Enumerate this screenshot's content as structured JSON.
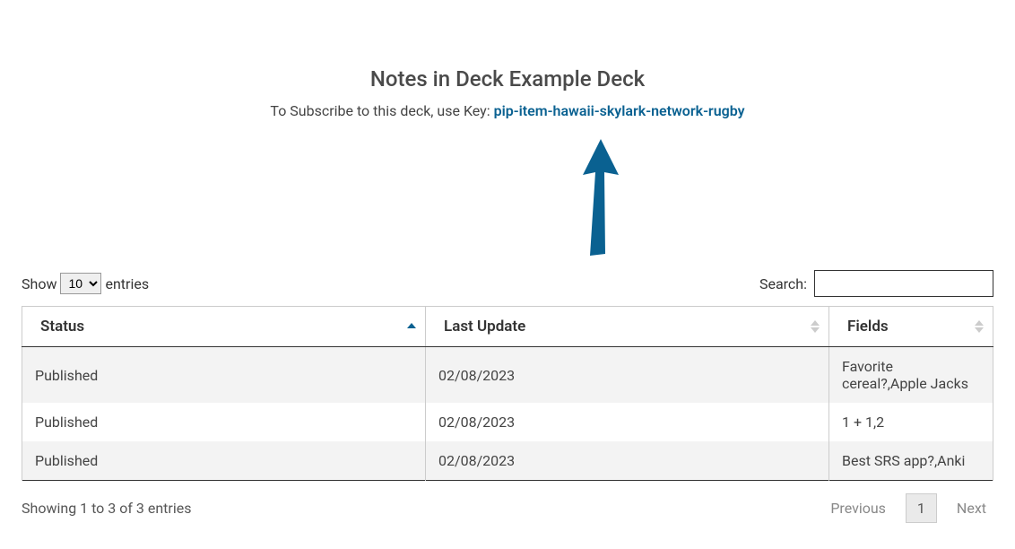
{
  "header": {
    "title": "Notes in Deck Example Deck",
    "subscribe_prefix": "To Subscribe to this deck, use Key: ",
    "key": "pip-item-hawaii-skylark-network-rugby"
  },
  "controls": {
    "show_label_pre": "Show",
    "show_label_post": "entries",
    "show_value": "10",
    "search_label": "Search:"
  },
  "table": {
    "columns": {
      "status": "Status",
      "last_update": "Last Update",
      "fields": "Fields"
    },
    "rows": [
      {
        "status": "Published",
        "last_update": "02/08/2023",
        "fields": "Favorite cereal?,Apple Jacks"
      },
      {
        "status": "Published",
        "last_update": "02/08/2023",
        "fields": "1 + 1,2"
      },
      {
        "status": "Published",
        "last_update": "02/08/2023",
        "fields": "Best SRS app?,Anki"
      }
    ]
  },
  "footer": {
    "info": "Showing 1 to 3 of 3 entries",
    "prev": "Previous",
    "page": "1",
    "next": "Next"
  }
}
